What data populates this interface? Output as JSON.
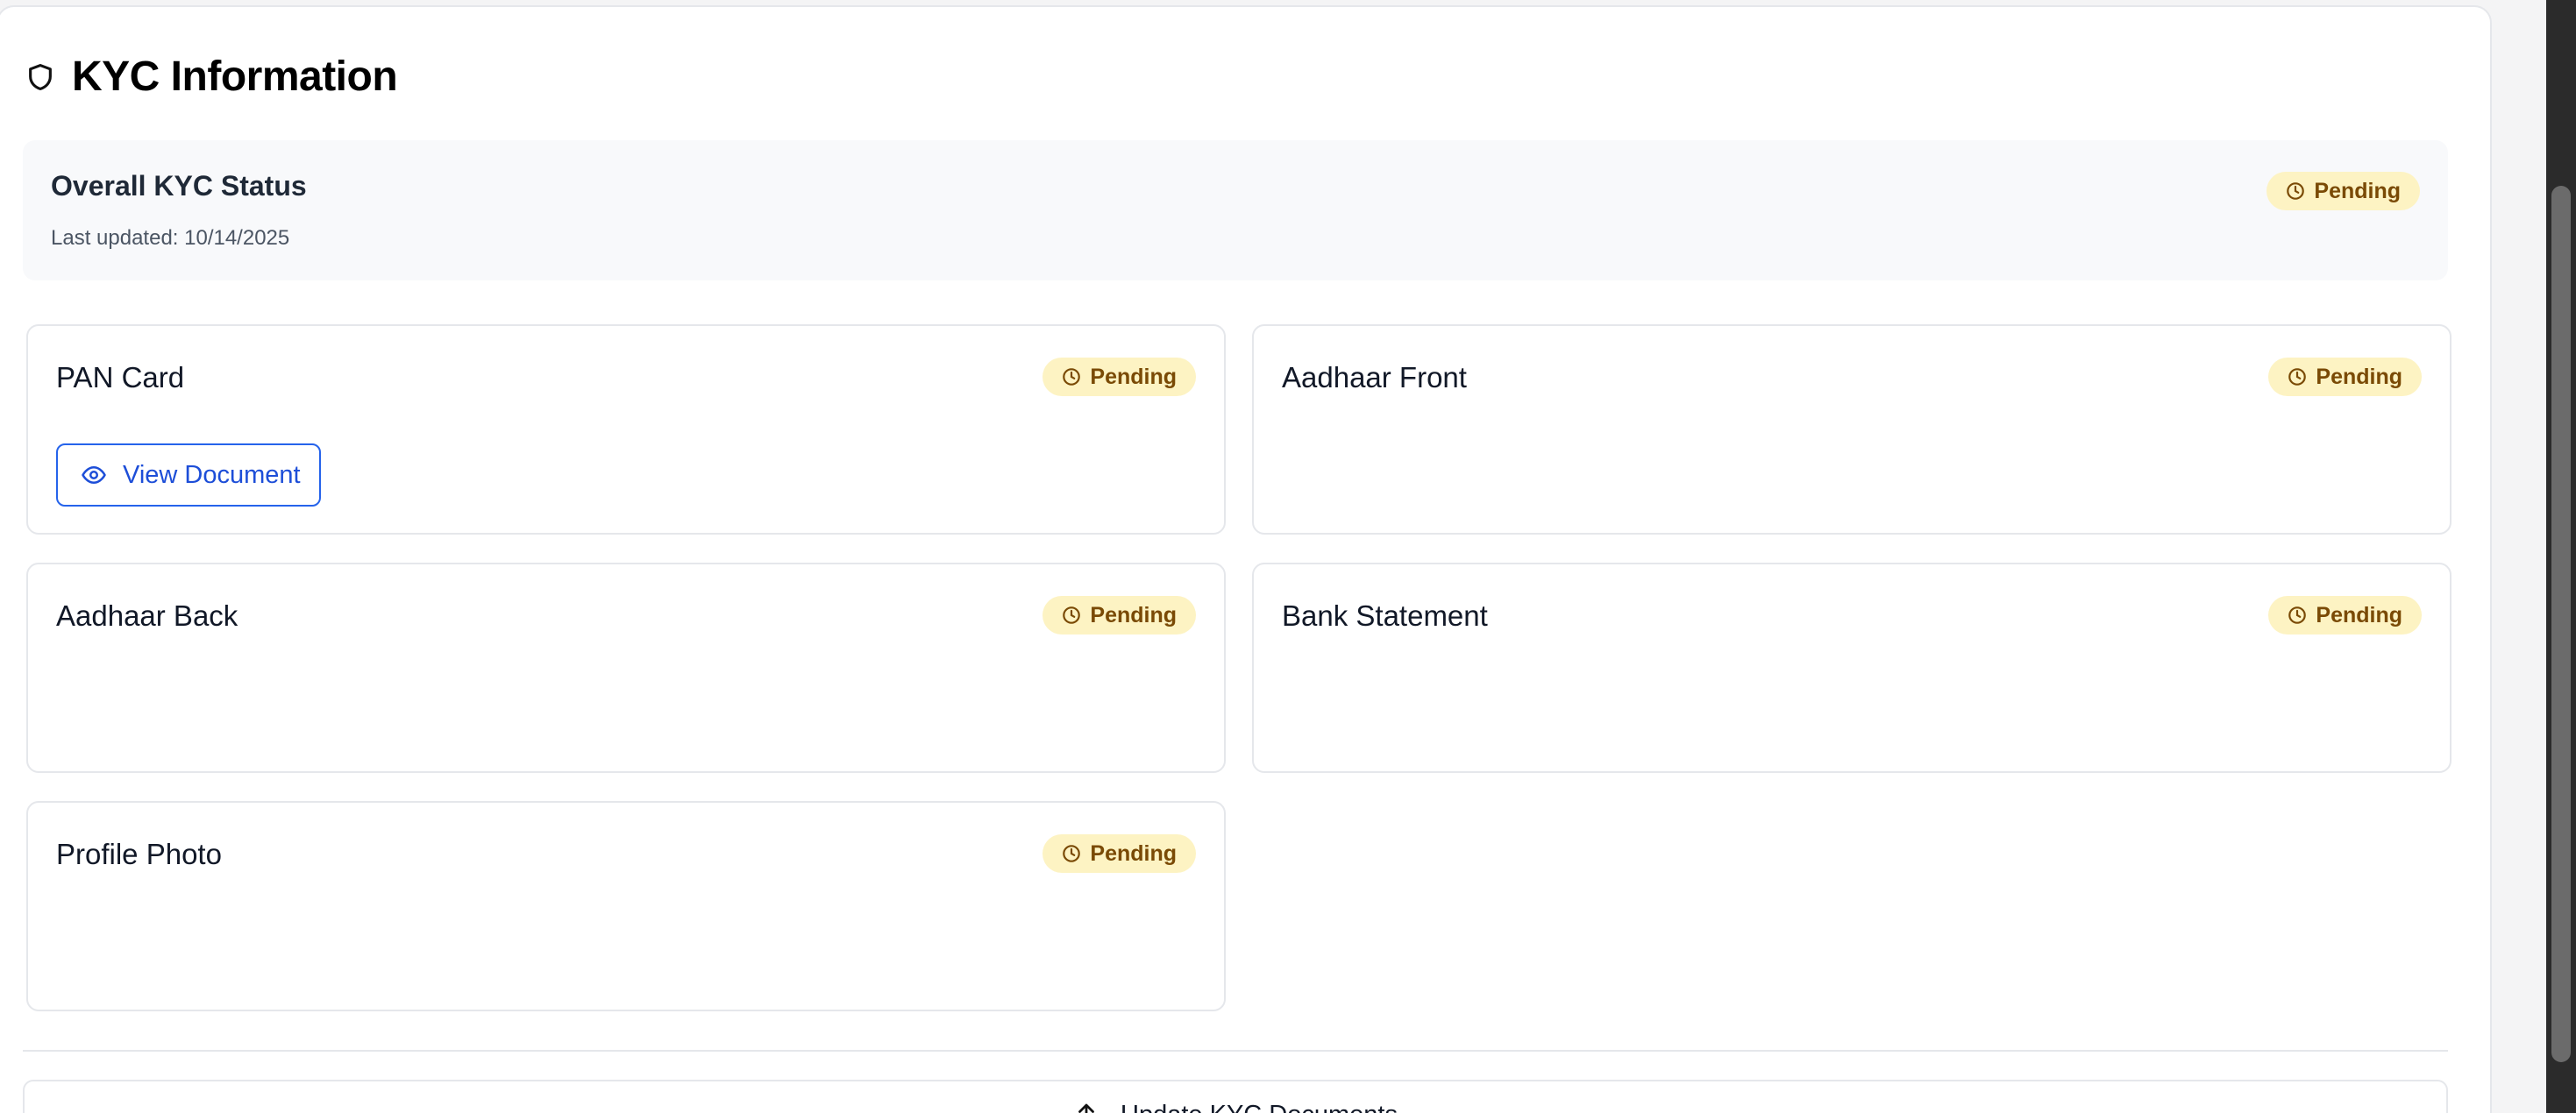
{
  "section": {
    "title": "KYC Information",
    "icon": "shield-icon"
  },
  "overall": {
    "title": "Overall KYC Status",
    "updated": "Last updated: 10/14/2025",
    "status": "Pending"
  },
  "documents": [
    {
      "name": "PAN Card",
      "status": "Pending",
      "action_label": "View Document"
    },
    {
      "name": "Aadhaar Front",
      "status": "Pending"
    },
    {
      "name": "Aadhaar Back",
      "status": "Pending"
    },
    {
      "name": "Bank Statement",
      "status": "Pending"
    },
    {
      "name": "Profile Photo",
      "status": "Pending"
    }
  ],
  "actions": {
    "update_label": "Update KYC Documents"
  },
  "colors": {
    "pending_bg": "#fdf3c3",
    "pending_text": "#7a4a05",
    "link_blue": "#1d4ed8"
  }
}
